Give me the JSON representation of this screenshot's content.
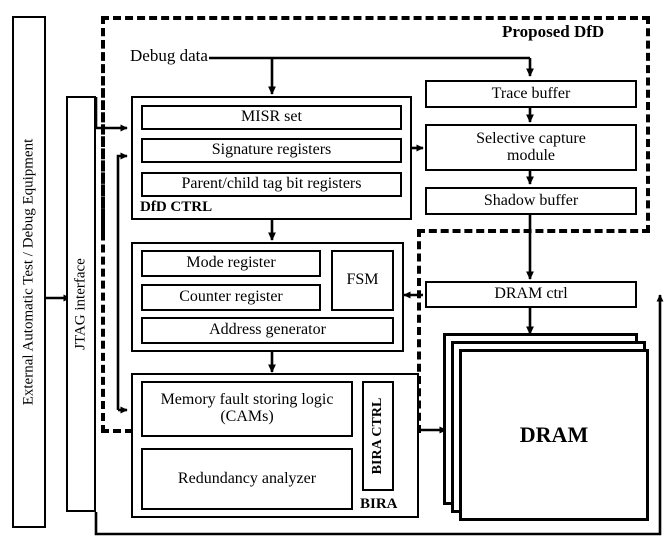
{
  "diagram": {
    "title_group": "Proposed DfD",
    "bira_group": "BIRA",
    "dfd_ctrl_group": "DfD CTRL",
    "debug_data_label": "Debug data",
    "external_equipment": "External Automatic Test / Debug Equipment",
    "jtag_interface": "JTAG interface",
    "bira_ctrl": "BIRA CTRL",
    "dram": "DRAM"
  },
  "dfd_ctrl": {
    "items": [
      {
        "label": "MISR set"
      },
      {
        "label": "Signature registers"
      },
      {
        "label": "Parent/child tag bit registers"
      }
    ]
  },
  "control_block": {
    "items": [
      {
        "label": "Mode register"
      },
      {
        "label": "Counter register"
      },
      {
        "label": "Address generator"
      },
      {
        "label": "FSM"
      }
    ]
  },
  "bira_block": {
    "items": [
      {
        "label": "Memory fault storing logic (CAMs)"
      },
      {
        "label": "Redundancy analyzer"
      }
    ]
  },
  "capture_chain": {
    "items": [
      {
        "label": "Trace buffer"
      },
      {
        "label": "Selective capture module"
      },
      {
        "label": "Shadow buffer"
      }
    ]
  },
  "memory_side": {
    "dram_ctrl": "DRAM ctrl",
    "dram": "DRAM"
  },
  "colors": {
    "stroke": "#000000",
    "background": "#ffffff"
  }
}
